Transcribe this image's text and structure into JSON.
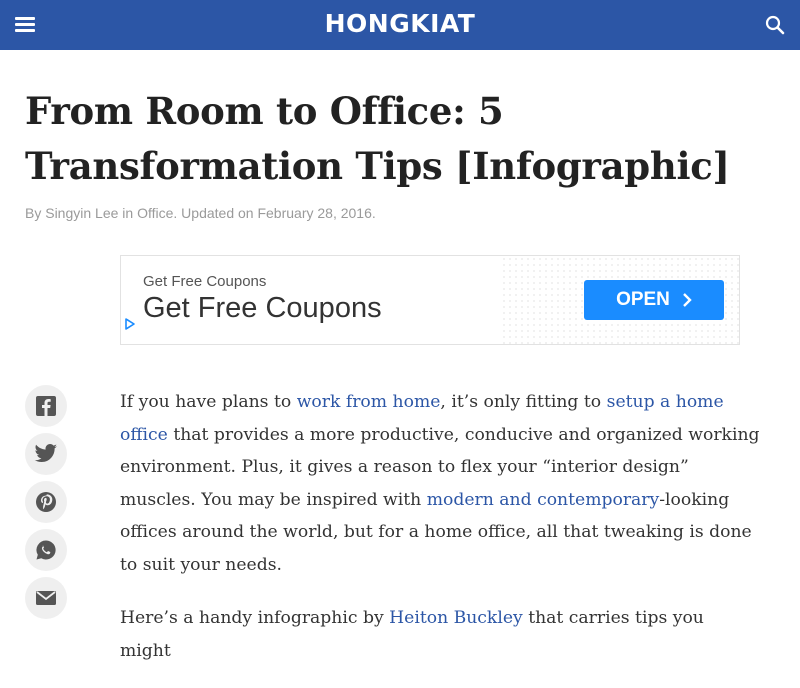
{
  "header": {
    "logo": "HONGKIAT",
    "menu_icon": "hamburger-menu-icon",
    "search_icon": "search-icon",
    "bg_color": "#2c56a6"
  },
  "article": {
    "title": "From Room to Office: 5 Transformation Tips [Infographic]",
    "meta": {
      "by": "By ",
      "author": "Singyin Lee",
      "in": " in ",
      "category": "Office",
      "updated": ". Updated on February 28, 2016."
    },
    "p1": {
      "t1": "If you have plans to ",
      "link1": "work from home",
      "t2": ", it’s only fitting to ",
      "link2": "setup a home office",
      "t3": " that provides a more productive, conducive and organized working environment. Plus, it gives a reason to flex your “interior design” muscles. You may be inspired with ",
      "link3": "modern and contemporary",
      "t4": "-looking offices around the world, but for a home office, all that tweaking is done to suit your needs."
    },
    "p2": {
      "t1": "Here’s a handy infographic by ",
      "link1": "Heiton Buckley",
      "t2": " that carries tips you might"
    },
    "link_color": "#2c56a6"
  },
  "ad": {
    "small_text": "Get Free Coupons",
    "big_text": "Get Free Coupons",
    "button_label": "OPEN",
    "button_color": "#1a8cff"
  },
  "social": {
    "buttons": [
      {
        "name": "facebook-icon"
      },
      {
        "name": "twitter-icon"
      },
      {
        "name": "pinterest-icon"
      },
      {
        "name": "whatsapp-icon"
      },
      {
        "name": "email-icon"
      }
    ]
  }
}
